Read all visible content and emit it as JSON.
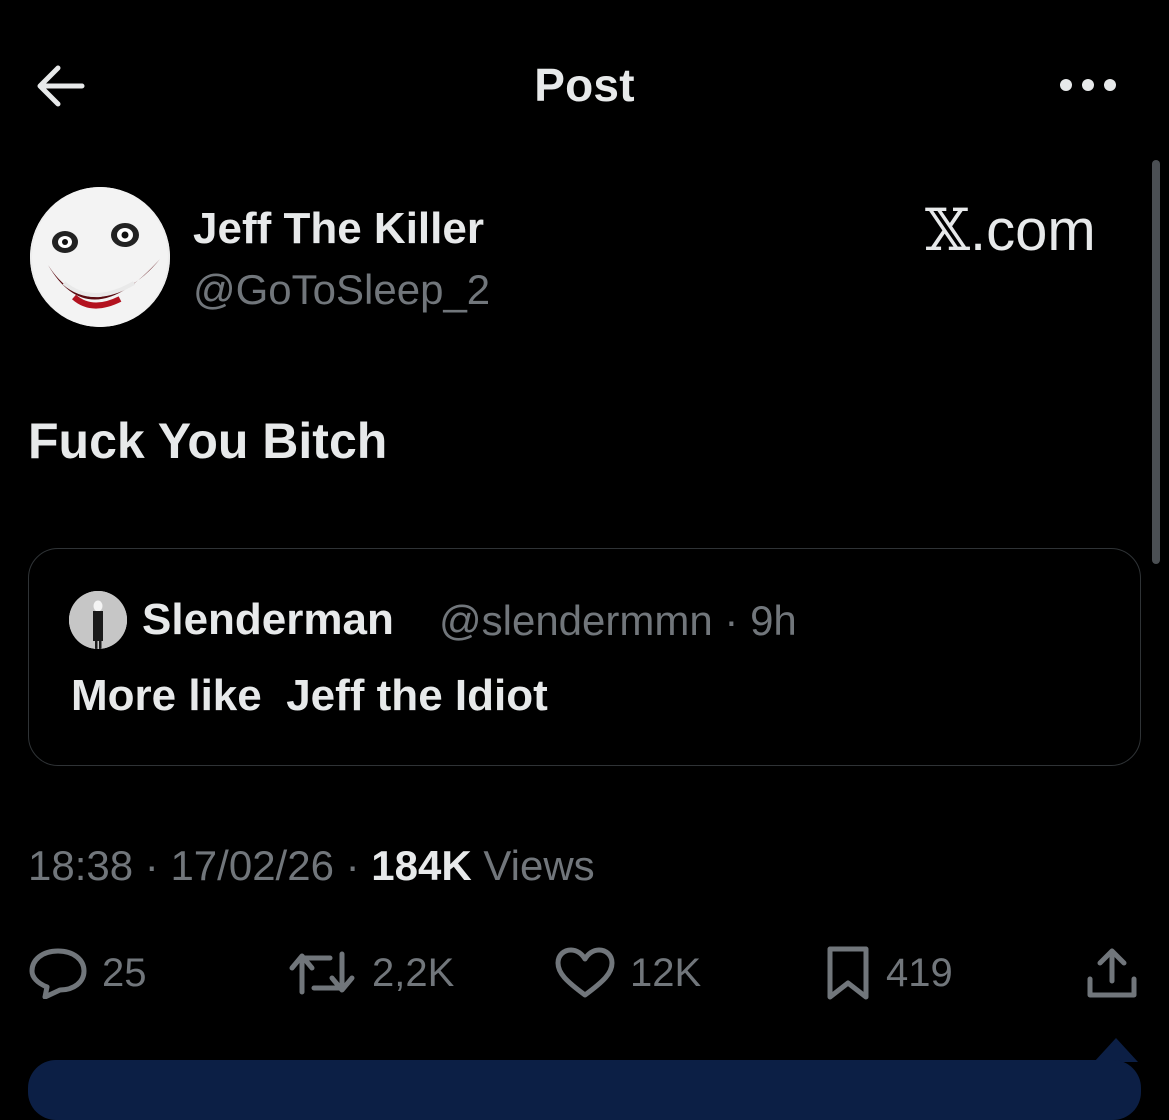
{
  "header": {
    "title": "Post"
  },
  "author": {
    "display_name": "Jeff The Killer",
    "handle": "@GoToSleep_2"
  },
  "watermark": {
    "glyph": "𝕏",
    "suffix": ".com"
  },
  "post": {
    "text": "Fuck You Bitch"
  },
  "quoted_post": {
    "display_name": "Slenderman",
    "handle": "@slendermmn",
    "separator": "·",
    "age": "9h",
    "text": "More like  Jeff the Idiot"
  },
  "meta": {
    "time": "18:38",
    "date": "17/02/26",
    "separator": "·",
    "views_count": "184K",
    "views_label": "Views"
  },
  "actions": {
    "replies": "25",
    "reposts": "2,2K",
    "likes": "12K",
    "bookmarks": "419"
  },
  "icons": {
    "back": "arrow-left-icon",
    "more": "more-dots-icon",
    "reply": "reply-bubble-icon",
    "repost": "repost-icon",
    "like": "heart-icon",
    "bookmark": "bookmark-icon",
    "share": "share-icon"
  },
  "colors": {
    "background": "#000000",
    "primary_text": "#e7e9ea",
    "secondary_text": "#71767b",
    "border": "#2f3336",
    "bottom_bar": "#0c1f45"
  }
}
